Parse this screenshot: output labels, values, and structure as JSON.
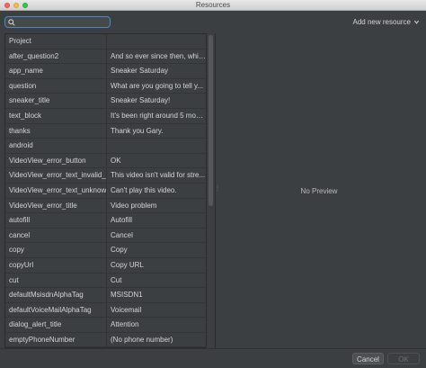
{
  "window": {
    "title": "Resources"
  },
  "search": {
    "value": "",
    "placeholder": ""
  },
  "toolbar": {
    "add_new_label": "Add new resource",
    "add_new_icon": "chevron-down-icon"
  },
  "table": {
    "rows": [
      {
        "name": "Project",
        "value": "",
        "group": true
      },
      {
        "name": "after_question2",
        "value": "And so ever since then, whil..."
      },
      {
        "name": "app_name",
        "value": "Sneaker Saturday"
      },
      {
        "name": "question",
        "value": "What are you going to tell y..."
      },
      {
        "name": "sneaker_title",
        "value": "Sneaker Saturday!"
      },
      {
        "name": "text_block",
        "value": "It's been right around 5 mon..."
      },
      {
        "name": "thanks",
        "value": "Thank you Gary."
      },
      {
        "name": "android",
        "value": "",
        "group": true
      },
      {
        "name": "VideoView_error_button",
        "value": "OK"
      },
      {
        "name": "VideoView_error_text_invalid_pro",
        "value": "This video isn't valid for stre..."
      },
      {
        "name": "VideoView_error_text_unknown",
        "value": "Can't play this video."
      },
      {
        "name": "VideoView_error_title",
        "value": "Video problem"
      },
      {
        "name": "autofill",
        "value": "Autofill"
      },
      {
        "name": "cancel",
        "value": "Cancel"
      },
      {
        "name": "copy",
        "value": "Copy"
      },
      {
        "name": "copyUrl",
        "value": "Copy URL"
      },
      {
        "name": "cut",
        "value": "Cut"
      },
      {
        "name": "defaultMsisdnAlphaTag",
        "value": "MSISDN1"
      },
      {
        "name": "defaultVoiceMailAlphaTag",
        "value": "Voicemail"
      },
      {
        "name": "dialog_alert_title",
        "value": "Attention"
      },
      {
        "name": "emptyPhoneNumber",
        "value": "(No phone number)"
      }
    ]
  },
  "preview": {
    "text": "No Preview"
  },
  "footer": {
    "cancel_label": "Cancel",
    "ok_label": "OK"
  },
  "colors": {
    "background": "#3c3f41",
    "focus_border": "#4a88c7",
    "text": "#d4d4d4"
  }
}
